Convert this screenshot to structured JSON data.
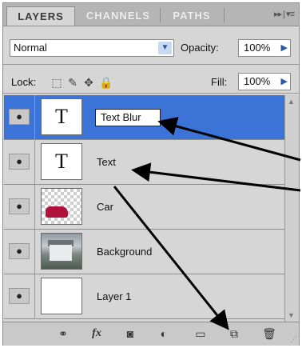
{
  "tabs": [
    {
      "label": "LAYERS",
      "active": true
    },
    {
      "label": "CHANNELS",
      "active": false
    },
    {
      "label": "PATHS",
      "active": false
    }
  ],
  "panel_menu_icon": "panel-menu-icon",
  "blend_mode": {
    "value": "Normal"
  },
  "opacity": {
    "label": "Opacity:",
    "value": "100%"
  },
  "lock": {
    "label": "Lock:",
    "icons": [
      "lock-transparent-icon",
      "lock-image-icon",
      "lock-position-icon",
      "lock-all-icon"
    ]
  },
  "fill": {
    "label": "Fill:",
    "value": "100%"
  },
  "layers": [
    {
      "name": "Text Blur",
      "type": "text",
      "thumb_glyph": "T",
      "visible": true,
      "selected": true,
      "renaming": true
    },
    {
      "name": "Text",
      "type": "text",
      "thumb_glyph": "T",
      "visible": true,
      "selected": false
    },
    {
      "name": "Car",
      "type": "image",
      "visible": true,
      "selected": false
    },
    {
      "name": "Background",
      "type": "photo",
      "visible": true,
      "selected": false
    },
    {
      "name": "Layer 1",
      "type": "blank",
      "visible": true,
      "selected": false
    }
  ],
  "eye_glyph": "●",
  "toolbar": [
    "link-layers-icon",
    "fx-icon",
    "layer-mask-icon",
    "adjustment-layer-icon",
    "new-group-icon",
    "new-layer-icon",
    "delete-icon"
  ],
  "toolbar_fx_label": "fx",
  "colors": {
    "selection": "#3b74d6",
    "panel": "#d6d6d6",
    "accent": "#2c5aa0"
  }
}
